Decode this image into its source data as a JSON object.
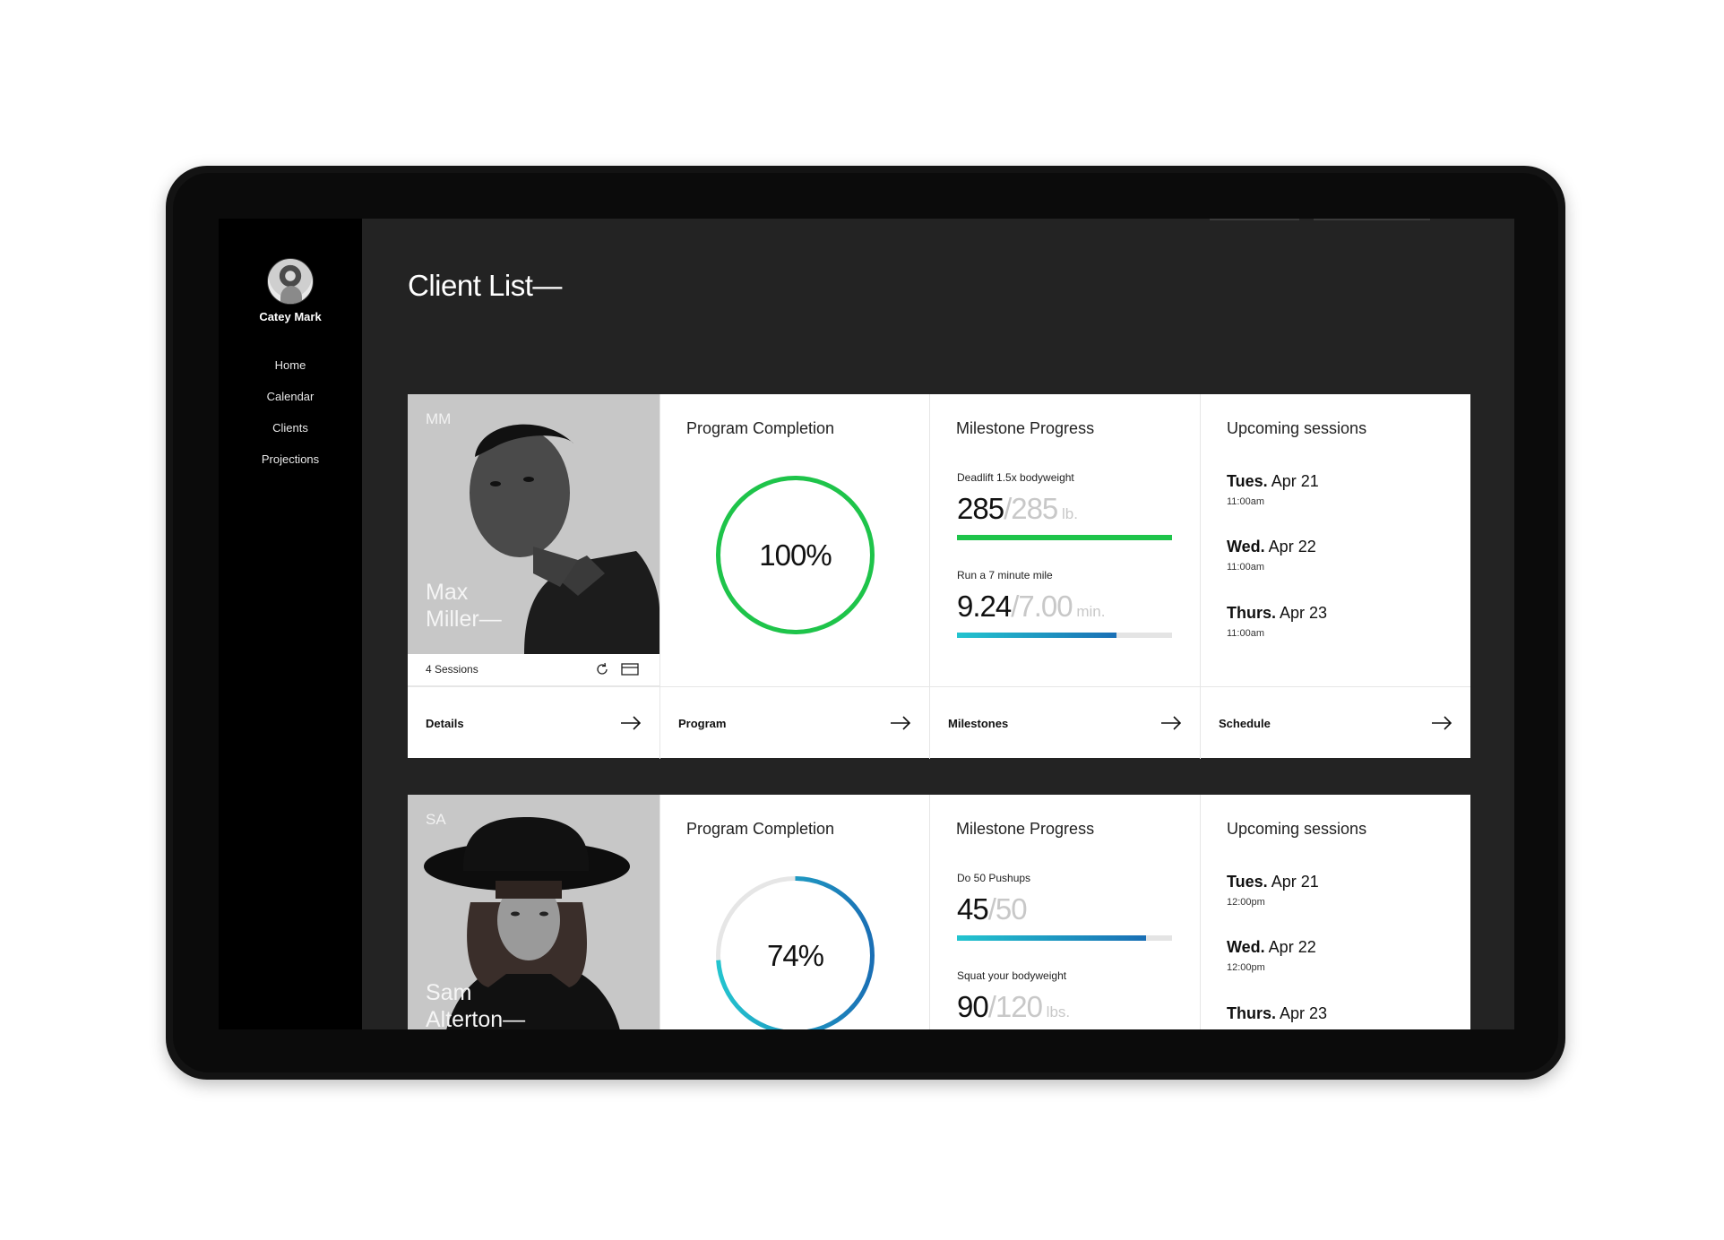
{
  "sidebar": {
    "user_name": "Catey Mark",
    "nav": [
      "Home",
      "Calendar",
      "Clients",
      "Projections"
    ]
  },
  "page_title": "Client List—",
  "clients": [
    {
      "initials": "MM",
      "name_line1": "Max",
      "name_line2": "Miller—",
      "sessions_label": "4 Sessions",
      "program": {
        "heading": "Program Completion",
        "value_label": "100%",
        "percent": 100,
        "colors": [
          "#1ec44a",
          "#1ec44a"
        ]
      },
      "milestones": {
        "heading": "Milestone Progress",
        "items": [
          {
            "task": "Deadlift 1.5x bodyweight",
            "current": "285",
            "target": "/285",
            "unit": " lb.",
            "fraction": 1.0,
            "color": "#1ec44a"
          },
          {
            "task": "Run a 7 minute mile",
            "current": "9.24",
            "target": "/7.00",
            "unit": " min.",
            "fraction": 0.74,
            "color": "#1d83c7"
          }
        ]
      },
      "sessions": {
        "heading": "Upcoming sessions",
        "items": [
          {
            "day": "Tues.",
            "date": " Apr 21",
            "time": "11:00am"
          },
          {
            "day": "Wed.",
            "date": " Apr 22",
            "time": "11:00am"
          },
          {
            "day": "Thurs.",
            "date": " Apr 23",
            "time": "11:00am"
          }
        ]
      },
      "actions": [
        "Details",
        "Program",
        "Milestones",
        "Schedule"
      ]
    },
    {
      "initials": "SA",
      "name_line1": "Sam",
      "name_line2": "Alterton—",
      "program": {
        "heading": "Program Completion",
        "value_label": "74%",
        "percent": 74,
        "colors": [
          "#23c4cf",
          "#1a6fb5"
        ]
      },
      "milestones": {
        "heading": "Milestone Progress",
        "items": [
          {
            "task": "Do 50 Pushups",
            "current": "45",
            "target": "/50",
            "unit": "",
            "fraction": 0.88,
            "color": "#1d83c7"
          },
          {
            "task": "Squat your bodyweight",
            "current": "90",
            "target": "/120",
            "unit": " lbs.",
            "fraction": 0.75,
            "color": "#1d83c7"
          }
        ]
      },
      "sessions": {
        "heading": "Upcoming sessions",
        "items": [
          {
            "day": "Tues.",
            "date": " Apr 21",
            "time": "12:00pm"
          },
          {
            "day": "Wed.",
            "date": " Apr 22",
            "time": "12:00pm"
          },
          {
            "day": "Thurs.",
            "date": " Apr 23",
            "time": ""
          }
        ]
      }
    }
  ]
}
